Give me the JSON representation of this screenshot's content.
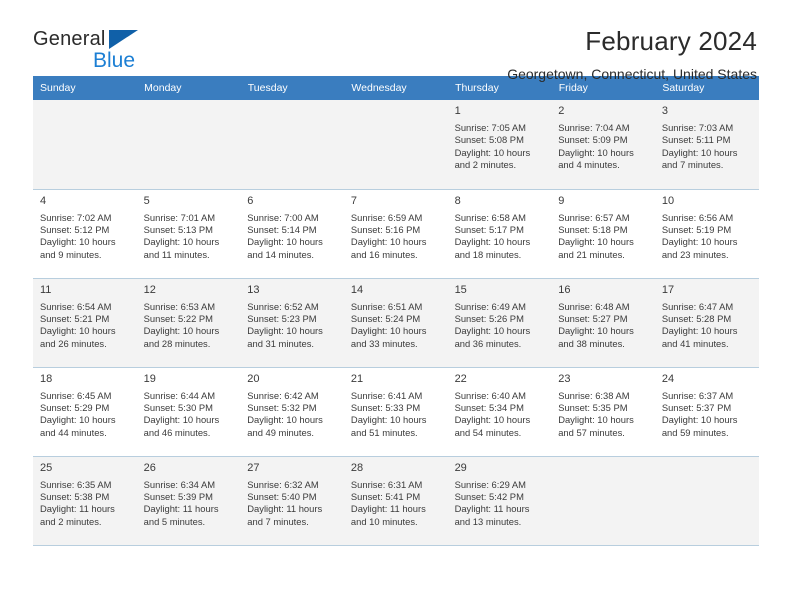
{
  "brand": {
    "name_top": "General",
    "name_bottom": "Blue",
    "triangle_color": "#1060a8",
    "blue_color": "#1c7fd4"
  },
  "header": {
    "title": "February 2024",
    "location": "Georgetown, Connecticut, United States"
  },
  "theme": {
    "header_bg": "#3a7dbf",
    "header_text": "#ffffff",
    "alt_row_bg": "#f3f3f3",
    "grid_line": "#b8cede"
  },
  "weekdays": [
    "Sunday",
    "Monday",
    "Tuesday",
    "Wednesday",
    "Thursday",
    "Friday",
    "Saturday"
  ],
  "weeks": [
    [
      {
        "day": "",
        "sunrise": "",
        "sunset": "",
        "daylight_1": "",
        "daylight_2": ""
      },
      {
        "day": "",
        "sunrise": "",
        "sunset": "",
        "daylight_1": "",
        "daylight_2": ""
      },
      {
        "day": "",
        "sunrise": "",
        "sunset": "",
        "daylight_1": "",
        "daylight_2": ""
      },
      {
        "day": "",
        "sunrise": "",
        "sunset": "",
        "daylight_1": "",
        "daylight_2": ""
      },
      {
        "day": "1",
        "sunrise": "Sunrise: 7:05 AM",
        "sunset": "Sunset: 5:08 PM",
        "daylight_1": "Daylight: 10 hours",
        "daylight_2": "and 2 minutes."
      },
      {
        "day": "2",
        "sunrise": "Sunrise: 7:04 AM",
        "sunset": "Sunset: 5:09 PM",
        "daylight_1": "Daylight: 10 hours",
        "daylight_2": "and 4 minutes."
      },
      {
        "day": "3",
        "sunrise": "Sunrise: 7:03 AM",
        "sunset": "Sunset: 5:11 PM",
        "daylight_1": "Daylight: 10 hours",
        "daylight_2": "and 7 minutes."
      }
    ],
    [
      {
        "day": "4",
        "sunrise": "Sunrise: 7:02 AM",
        "sunset": "Sunset: 5:12 PM",
        "daylight_1": "Daylight: 10 hours",
        "daylight_2": "and 9 minutes."
      },
      {
        "day": "5",
        "sunrise": "Sunrise: 7:01 AM",
        "sunset": "Sunset: 5:13 PM",
        "daylight_1": "Daylight: 10 hours",
        "daylight_2": "and 11 minutes."
      },
      {
        "day": "6",
        "sunrise": "Sunrise: 7:00 AM",
        "sunset": "Sunset: 5:14 PM",
        "daylight_1": "Daylight: 10 hours",
        "daylight_2": "and 14 minutes."
      },
      {
        "day": "7",
        "sunrise": "Sunrise: 6:59 AM",
        "sunset": "Sunset: 5:16 PM",
        "daylight_1": "Daylight: 10 hours",
        "daylight_2": "and 16 minutes."
      },
      {
        "day": "8",
        "sunrise": "Sunrise: 6:58 AM",
        "sunset": "Sunset: 5:17 PM",
        "daylight_1": "Daylight: 10 hours",
        "daylight_2": "and 18 minutes."
      },
      {
        "day": "9",
        "sunrise": "Sunrise: 6:57 AM",
        "sunset": "Sunset: 5:18 PM",
        "daylight_1": "Daylight: 10 hours",
        "daylight_2": "and 21 minutes."
      },
      {
        "day": "10",
        "sunrise": "Sunrise: 6:56 AM",
        "sunset": "Sunset: 5:19 PM",
        "daylight_1": "Daylight: 10 hours",
        "daylight_2": "and 23 minutes."
      }
    ],
    [
      {
        "day": "11",
        "sunrise": "Sunrise: 6:54 AM",
        "sunset": "Sunset: 5:21 PM",
        "daylight_1": "Daylight: 10 hours",
        "daylight_2": "and 26 minutes."
      },
      {
        "day": "12",
        "sunrise": "Sunrise: 6:53 AM",
        "sunset": "Sunset: 5:22 PM",
        "daylight_1": "Daylight: 10 hours",
        "daylight_2": "and 28 minutes."
      },
      {
        "day": "13",
        "sunrise": "Sunrise: 6:52 AM",
        "sunset": "Sunset: 5:23 PM",
        "daylight_1": "Daylight: 10 hours",
        "daylight_2": "and 31 minutes."
      },
      {
        "day": "14",
        "sunrise": "Sunrise: 6:51 AM",
        "sunset": "Sunset: 5:24 PM",
        "daylight_1": "Daylight: 10 hours",
        "daylight_2": "and 33 minutes."
      },
      {
        "day": "15",
        "sunrise": "Sunrise: 6:49 AM",
        "sunset": "Sunset: 5:26 PM",
        "daylight_1": "Daylight: 10 hours",
        "daylight_2": "and 36 minutes."
      },
      {
        "day": "16",
        "sunrise": "Sunrise: 6:48 AM",
        "sunset": "Sunset: 5:27 PM",
        "daylight_1": "Daylight: 10 hours",
        "daylight_2": "and 38 minutes."
      },
      {
        "day": "17",
        "sunrise": "Sunrise: 6:47 AM",
        "sunset": "Sunset: 5:28 PM",
        "daylight_1": "Daylight: 10 hours",
        "daylight_2": "and 41 minutes."
      }
    ],
    [
      {
        "day": "18",
        "sunrise": "Sunrise: 6:45 AM",
        "sunset": "Sunset: 5:29 PM",
        "daylight_1": "Daylight: 10 hours",
        "daylight_2": "and 44 minutes."
      },
      {
        "day": "19",
        "sunrise": "Sunrise: 6:44 AM",
        "sunset": "Sunset: 5:30 PM",
        "daylight_1": "Daylight: 10 hours",
        "daylight_2": "and 46 minutes."
      },
      {
        "day": "20",
        "sunrise": "Sunrise: 6:42 AM",
        "sunset": "Sunset: 5:32 PM",
        "daylight_1": "Daylight: 10 hours",
        "daylight_2": "and 49 minutes."
      },
      {
        "day": "21",
        "sunrise": "Sunrise: 6:41 AM",
        "sunset": "Sunset: 5:33 PM",
        "daylight_1": "Daylight: 10 hours",
        "daylight_2": "and 51 minutes."
      },
      {
        "day": "22",
        "sunrise": "Sunrise: 6:40 AM",
        "sunset": "Sunset: 5:34 PM",
        "daylight_1": "Daylight: 10 hours",
        "daylight_2": "and 54 minutes."
      },
      {
        "day": "23",
        "sunrise": "Sunrise: 6:38 AM",
        "sunset": "Sunset: 5:35 PM",
        "daylight_1": "Daylight: 10 hours",
        "daylight_2": "and 57 minutes."
      },
      {
        "day": "24",
        "sunrise": "Sunrise: 6:37 AM",
        "sunset": "Sunset: 5:37 PM",
        "daylight_1": "Daylight: 10 hours",
        "daylight_2": "and 59 minutes."
      }
    ],
    [
      {
        "day": "25",
        "sunrise": "Sunrise: 6:35 AM",
        "sunset": "Sunset: 5:38 PM",
        "daylight_1": "Daylight: 11 hours",
        "daylight_2": "and 2 minutes."
      },
      {
        "day": "26",
        "sunrise": "Sunrise: 6:34 AM",
        "sunset": "Sunset: 5:39 PM",
        "daylight_1": "Daylight: 11 hours",
        "daylight_2": "and 5 minutes."
      },
      {
        "day": "27",
        "sunrise": "Sunrise: 6:32 AM",
        "sunset": "Sunset: 5:40 PM",
        "daylight_1": "Daylight: 11 hours",
        "daylight_2": "and 7 minutes."
      },
      {
        "day": "28",
        "sunrise": "Sunrise: 6:31 AM",
        "sunset": "Sunset: 5:41 PM",
        "daylight_1": "Daylight: 11 hours",
        "daylight_2": "and 10 minutes."
      },
      {
        "day": "29",
        "sunrise": "Sunrise: 6:29 AM",
        "sunset": "Sunset: 5:42 PM",
        "daylight_1": "Daylight: 11 hours",
        "daylight_2": "and 13 minutes."
      },
      {
        "day": "",
        "sunrise": "",
        "sunset": "",
        "daylight_1": "",
        "daylight_2": ""
      },
      {
        "day": "",
        "sunrise": "",
        "sunset": "",
        "daylight_1": "",
        "daylight_2": ""
      }
    ]
  ]
}
